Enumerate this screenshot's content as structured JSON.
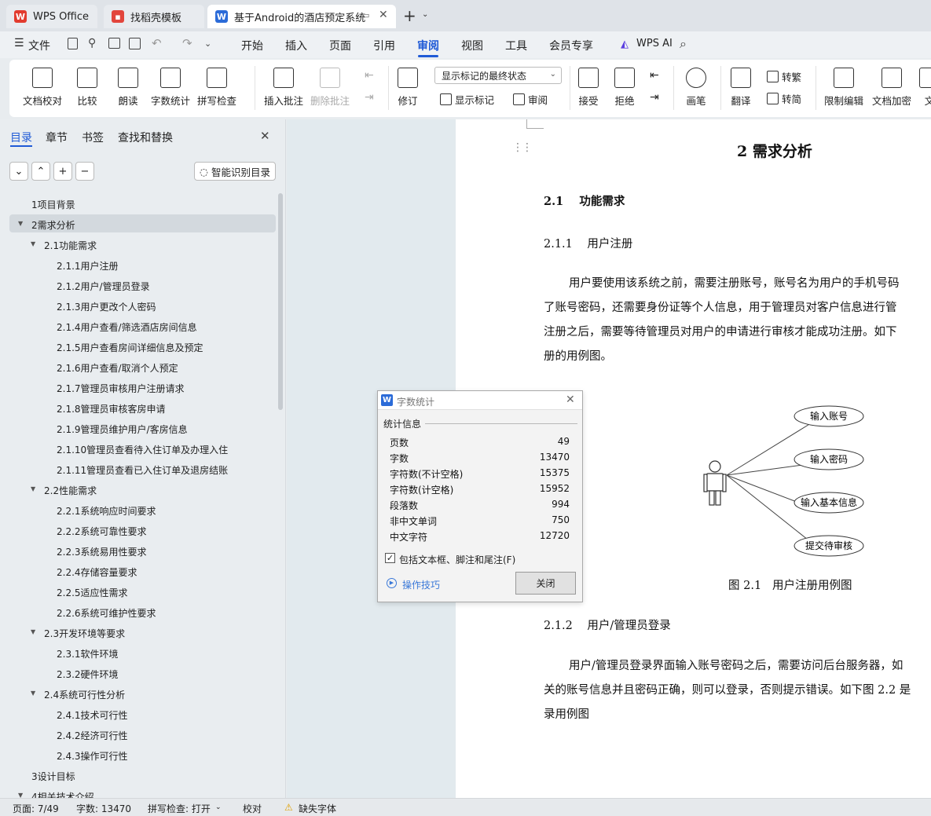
{
  "tabs": [
    {
      "label": "WPS Office",
      "icon": "wps-logo-icon"
    },
    {
      "label": "找稻壳模板",
      "icon": "docer-icon"
    },
    {
      "label": "基于Android的酒店预定系统",
      "icon": "writer-doc-icon"
    }
  ],
  "menu": {
    "file": "文件",
    "items": [
      "开始",
      "插入",
      "页面",
      "引用",
      "审阅",
      "视图",
      "工具",
      "会员专享"
    ],
    "active": "审阅",
    "ai": "WPS AI"
  },
  "ribbon": {
    "proof": "文档校对",
    "compare": "比较",
    "read_aloud": "朗读",
    "word_count": "字数统计",
    "spell": "拼写检查",
    "insert_comment": "插入批注",
    "delete_comment": "删除批注",
    "markup_state": "显示标记的最终状态",
    "revise": "修订",
    "show_markup": "显示标记",
    "review": "审阅",
    "accept": "接受",
    "reject": "拒绝",
    "pen": "画笔",
    "translate": "翻译",
    "to_trad": "转繁",
    "to_simp": "转简",
    "restrict": "限制编辑",
    "encrypt": "文档加密",
    "more": "文"
  },
  "panel": {
    "tabs": [
      "目录",
      "章节",
      "书签",
      "查找和替换"
    ],
    "active": "目录",
    "smart": "智能识别目录"
  },
  "toc": [
    {
      "t": "1项目背景",
      "l": 1
    },
    {
      "t": "2需求分析",
      "l": 1,
      "open": true,
      "sel": true
    },
    {
      "t": "2.1功能需求",
      "l": 2,
      "open": true
    },
    {
      "t": "2.1.1用户注册",
      "l": 3
    },
    {
      "t": "2.1.2用户/管理员登录",
      "l": 3
    },
    {
      "t": "2.1.3用户更改个人密码",
      "l": 3
    },
    {
      "t": "2.1.4用户查看/筛选酒店房间信息",
      "l": 3
    },
    {
      "t": "2.1.5用户查看房间详细信息及预定",
      "l": 3
    },
    {
      "t": "2.1.6用户查看/取消个人预定",
      "l": 3
    },
    {
      "t": "2.1.7管理员审核用户注册请求",
      "l": 3
    },
    {
      "t": "2.1.8管理员审核客房申请",
      "l": 3
    },
    {
      "t": "2.1.9管理员维护用户/客房信息",
      "l": 3
    },
    {
      "t": "2.1.10管理员查看待入住订单及办理入住",
      "l": 3
    },
    {
      "t": "2.1.11管理员查看已入住订单及退房结账",
      "l": 3
    },
    {
      "t": "2.2性能需求",
      "l": 2,
      "open": true
    },
    {
      "t": "2.2.1系统响应时间要求",
      "l": 3
    },
    {
      "t": "2.2.2系统可靠性要求",
      "l": 3
    },
    {
      "t": "2.2.3系统易用性要求",
      "l": 3
    },
    {
      "t": "2.2.4存储容量要求",
      "l": 3
    },
    {
      "t": "2.2.5适应性需求",
      "l": 3
    },
    {
      "t": "2.2.6系统可维护性要求",
      "l": 3
    },
    {
      "t": "2.3开发环境等要求",
      "l": 2,
      "open": true
    },
    {
      "t": "2.3.1软件环境",
      "l": 3
    },
    {
      "t": "2.3.2硬件环境",
      "l": 3
    },
    {
      "t": "2.4系统可行性分析",
      "l": 2,
      "open": true
    },
    {
      "t": "2.4.1技术可行性",
      "l": 3
    },
    {
      "t": "2.4.2经济可行性",
      "l": 3
    },
    {
      "t": "2.4.3操作可行性",
      "l": 3
    },
    {
      "t": "3设计目标",
      "l": 1
    },
    {
      "t": "4相关技术介绍",
      "l": 1,
      "open": true
    }
  ],
  "doc": {
    "h1": "2   需求分析",
    "h2": "2.1    功能需求",
    "h3a": "2.1.1    用户注册",
    "p1": [
      "用户要使用该系统之前，需要注册账号，账号名为用户的手机号码",
      "了账号密码，还需要身份证等个人信息，用于管理员对客户信息进行管",
      "注册之后，需要等待管理员对用户的申请进行审核才能成功注册。如下",
      "册的用例图。"
    ],
    "uc": [
      "输入账号",
      "输入密码",
      "输入基本信息",
      "提交待审核"
    ],
    "caption": "图 2.1   用户注册用例图",
    "h3b": "2.1.2    用户/管理员登录",
    "p2": [
      "用户/管理员登录界面输入账号密码之后，需要访问后台服务器，如",
      "关的账号信息并且密码正确，则可以登录，否则提示错误。如下图 2.2 是",
      "录用例图"
    ]
  },
  "dialog": {
    "title": "字数统计",
    "section": "统计信息",
    "rows": [
      [
        "页数",
        "49"
      ],
      [
        "字数",
        "13470"
      ],
      [
        "字符数(不计空格)",
        "15375"
      ],
      [
        "字符数(计空格)",
        "15952"
      ],
      [
        "段落数",
        "994"
      ],
      [
        "非中文单词",
        "750"
      ],
      [
        "中文字符",
        "12720"
      ]
    ],
    "include": "包括文本框、脚注和尾注(F)",
    "tips": "操作技巧",
    "close": "关闭"
  },
  "status": {
    "page": "页面: 7/49",
    "words": "字数: 13470",
    "spell": "拼写检查: 打开",
    "proof": "校对",
    "font": "缺失字体"
  }
}
